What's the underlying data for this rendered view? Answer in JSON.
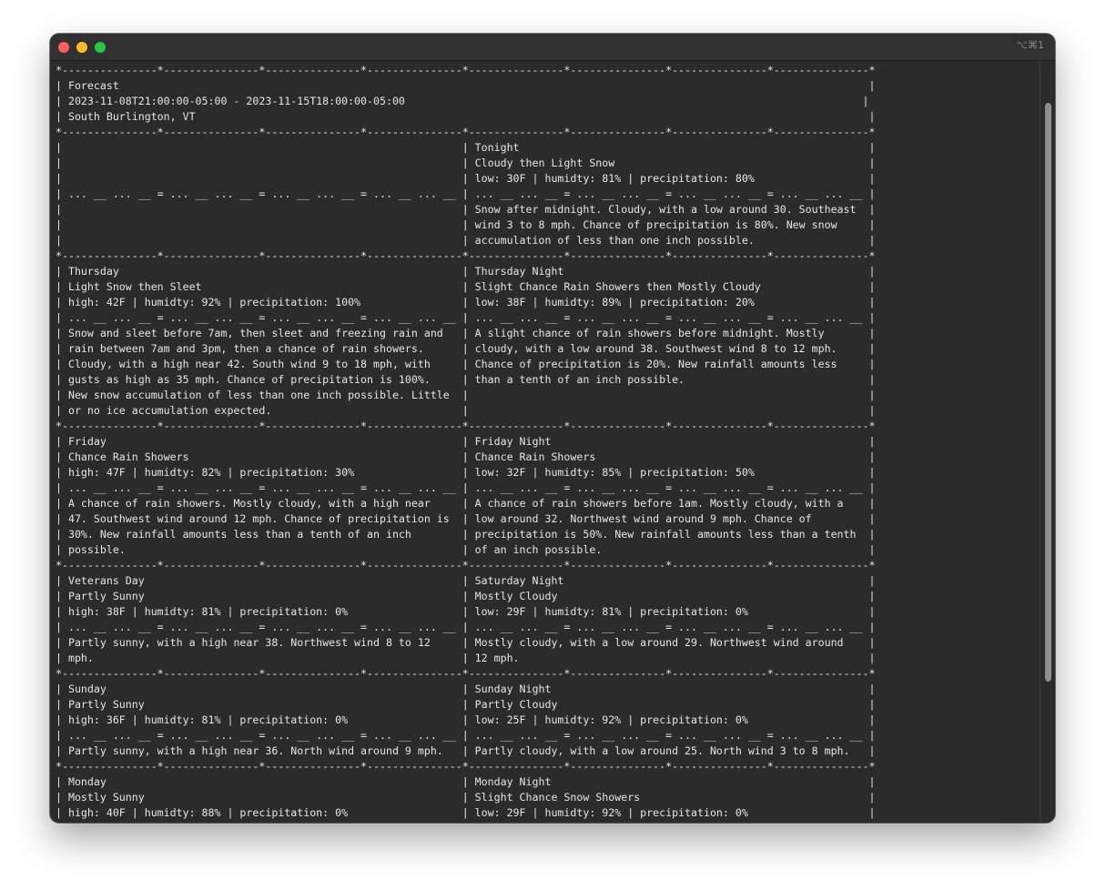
{
  "window": {
    "shortcut": "⌥⌘1"
  },
  "terminal": {
    "lines": [
      "*---------------*---------------*---------------*---------------*---------------*---------------*---------------*---------------*",
      "| Forecast                                                                                                                      |",
      "| 2023-11-08T21:00:00-05:00 - 2023-11-15T18:00:00-05:00                                                                        |",
      "| South Burlington, VT                                                                                                          |",
      "*---------------*---------------*---------------*---------------*---------------*---------------*---------------*---------------*",
      "|                                                               | Tonight                                                       |",
      "|                                                               | Cloudy then Light Snow                                        |",
      "|                                                               | low: 30F | humidty: 81% | precipitation: 80%                  |",
      "| ... __ ... __ = ... __ ... __ = ... __ ... __ = ... __ ... __ | ... __ ... __ = ... __ ... __ = ... __ ... __ = ... __ ... __ |",
      "|                                                               | Snow after midnight. Cloudy, with a low around 30. Southeast  |",
      "|                                                               | wind 3 to 8 mph. Chance of precipitation is 80%. New snow     |",
      "|                                                               | accumulation of less than one inch possible.                  |",
      "*---------------*---------------*---------------*---------------*---------------*---------------*---------------*---------------*",
      "| Thursday                                                      | Thursday Night                                                |",
      "| Light Snow then Sleet                                         | Slight Chance Rain Showers then Mostly Cloudy                 |",
      "| high: 42F | humidty: 92% | precipitation: 100%                | low: 38F | humidty: 89% | precipitation: 20%                  |",
      "| ... __ ... __ = ... __ ... __ = ... __ ... __ = ... __ ... __ | ... __ ... __ = ... __ ... __ = ... __ ... __ = ... __ ... __ |",
      "| Snow and sleet before 7am, then sleet and freezing rain and   | A slight chance of rain showers before midnight. Mostly       |",
      "| rain between 7am and 3pm, then a chance of rain showers.      | cloudy, with a low around 38. Southwest wind 8 to 12 mph.     |",
      "| Cloudy, with a high near 42. South wind 9 to 18 mph, with     | Chance of precipitation is 20%. New rainfall amounts less     |",
      "| gusts as high as 35 mph. Chance of precipitation is 100%.     | than a tenth of an inch possible.                             |",
      "| New snow accumulation of less than one inch possible. Little  |                                                               |",
      "| or no ice accumulation expected.                              |                                                               |",
      "*---------------*---------------*---------------*---------------*---------------*---------------*---------------*---------------*",
      "| Friday                                                        | Friday Night                                                  |",
      "| Chance Rain Showers                                           | Chance Rain Showers                                           |",
      "| high: 47F | humidty: 82% | precipitation: 30%                 | low: 32F | humidty: 85% | precipitation: 50%                  |",
      "| ... __ ... __ = ... __ ... __ = ... __ ... __ = ... __ ... __ | ... __ ... __ = ... __ ... __ = ... __ ... __ = ... __ ... __ |",
      "| A chance of rain showers. Mostly cloudy, with a high near     | A chance of rain showers before 1am. Mostly cloudy, with a    |",
      "| 47. Southwest wind around 12 mph. Chance of precipitation is  | low around 32. Northwest wind around 9 mph. Chance of         |",
      "| 30%. New rainfall amounts less than a tenth of an inch        | precipitation is 50%. New rainfall amounts less than a tenth  |",
      "| possible.                                                     | of an inch possible.                                          |",
      "*---------------*---------------*---------------*---------------*---------------*---------------*---------------*---------------*",
      "| Veterans Day                                                  | Saturday Night                                                |",
      "| Partly Sunny                                                  | Mostly Cloudy                                                 |",
      "| high: 38F | humidty: 81% | precipitation: 0%                  | low: 29F | humidty: 81% | precipitation: 0%                   |",
      "| ... __ ... __ = ... __ ... __ = ... __ ... __ = ... __ ... __ | ... __ ... __ = ... __ ... __ = ... __ ... __ = ... __ ... __ |",
      "| Partly sunny, with a high near 38. Northwest wind 8 to 12     | Mostly cloudy, with a low around 29. Northwest wind around    |",
      "| mph.                                                          | 12 mph.                                                       |",
      "*---------------*---------------*---------------*---------------*---------------*---------------*---------------*---------------*",
      "| Sunday                                                        | Sunday Night                                                  |",
      "| Partly Sunny                                                  | Partly Cloudy                                                 |",
      "| high: 36F | humidty: 81% | precipitation: 0%                  | low: 25F | humidty: 92% | precipitation: 0%                   |",
      "| ... __ ... __ = ... __ ... __ = ... __ ... __ = ... __ ... __ | ... __ ... __ = ... __ ... __ = ... __ ... __ = ... __ ... __ |",
      "| Partly sunny, with a high near 36. North wind around 9 mph.   | Partly cloudy, with a low around 25. North wind 3 to 8 mph.   |",
      "*---------------*---------------*---------------*---------------*---------------*---------------*---------------*---------------*",
      "| Monday                                                        | Monday Night                                                  |",
      "| Mostly Sunny                                                  | Slight Chance Snow Showers                                    |",
      "| high: 40F | humidty: 88% | precipitation: 0%                  | low: 29F | humidty: 92% | precipitation: 0%                   |"
    ]
  }
}
